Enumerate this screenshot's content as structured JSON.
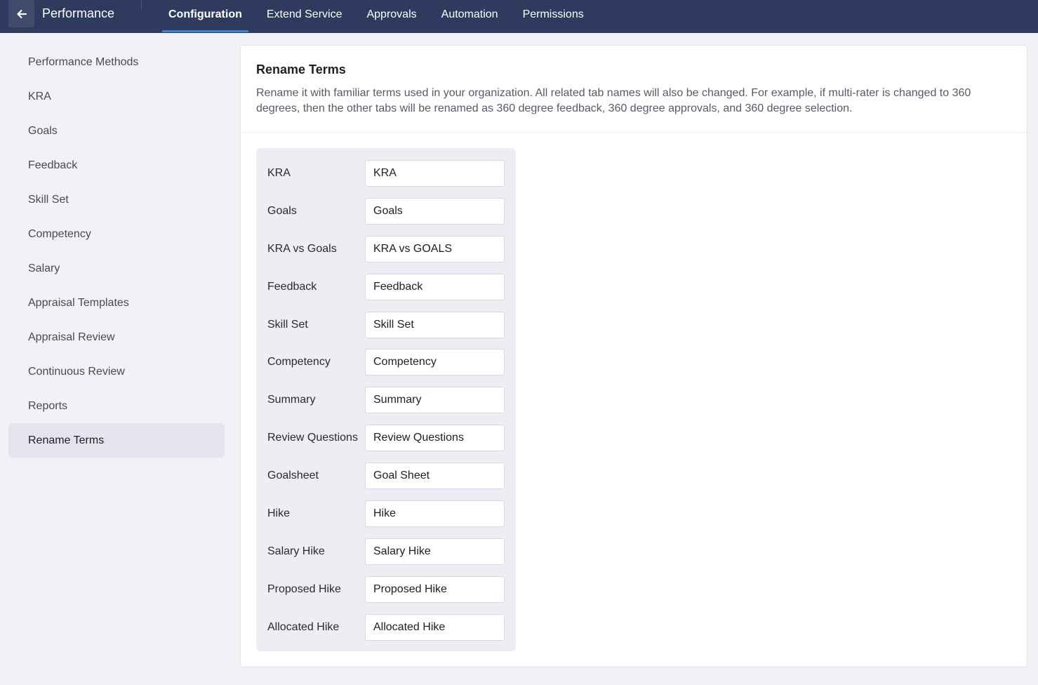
{
  "topbar": {
    "module_title": "Performance",
    "tabs": [
      {
        "label": "Configuration",
        "active": true
      },
      {
        "label": "Extend Service",
        "active": false
      },
      {
        "label": "Approvals",
        "active": false
      },
      {
        "label": "Automation",
        "active": false
      },
      {
        "label": "Permissions",
        "active": false
      }
    ]
  },
  "sidebar": {
    "items": [
      {
        "label": "Performance Methods"
      },
      {
        "label": "KRA"
      },
      {
        "label": "Goals"
      },
      {
        "label": "Feedback"
      },
      {
        "label": "Skill Set"
      },
      {
        "label": "Competency"
      },
      {
        "label": "Salary"
      },
      {
        "label": "Appraisal Templates"
      },
      {
        "label": "Appraisal Review"
      },
      {
        "label": "Continuous Review"
      },
      {
        "label": "Reports"
      },
      {
        "label": "Rename Terms",
        "active": true
      }
    ]
  },
  "main": {
    "title": "Rename Terms",
    "description": "Rename it with familiar terms used in your organization. All related tab names will also be changed. For example, if multi-rater is changed to 360 degrees, then the other tabs will be renamed as 360 degree feedback, 360 degree approvals, and 360 degree selection.",
    "terms": [
      {
        "label": "KRA",
        "value": "KRA"
      },
      {
        "label": "Goals",
        "value": "Goals"
      },
      {
        "label": "KRA vs Goals",
        "value": "KRA vs GOALS"
      },
      {
        "label": "Feedback",
        "value": "Feedback"
      },
      {
        "label": "Skill Set",
        "value": "Skill Set"
      },
      {
        "label": "Competency",
        "value": "Competency"
      },
      {
        "label": "Summary",
        "value": "Summary"
      },
      {
        "label": "Review Questions",
        "value": "Review Questions"
      },
      {
        "label": "Goalsheet",
        "value": "Goal Sheet"
      },
      {
        "label": "Hike",
        "value": "Hike"
      },
      {
        "label": "Salary Hike",
        "value": "Salary Hike"
      },
      {
        "label": "Proposed Hike",
        "value": "Proposed Hike"
      },
      {
        "label": "Allocated Hike",
        "value": "Allocated Hike"
      }
    ]
  },
  "colors": {
    "topbar_bg": "#2e3b5e",
    "active_tab_underline": "#1b8cf0",
    "page_bg": "#f1f2f6",
    "sidebar_active_bg": "#e3e4ee"
  },
  "icons": {
    "back": "arrow-left-icon"
  }
}
